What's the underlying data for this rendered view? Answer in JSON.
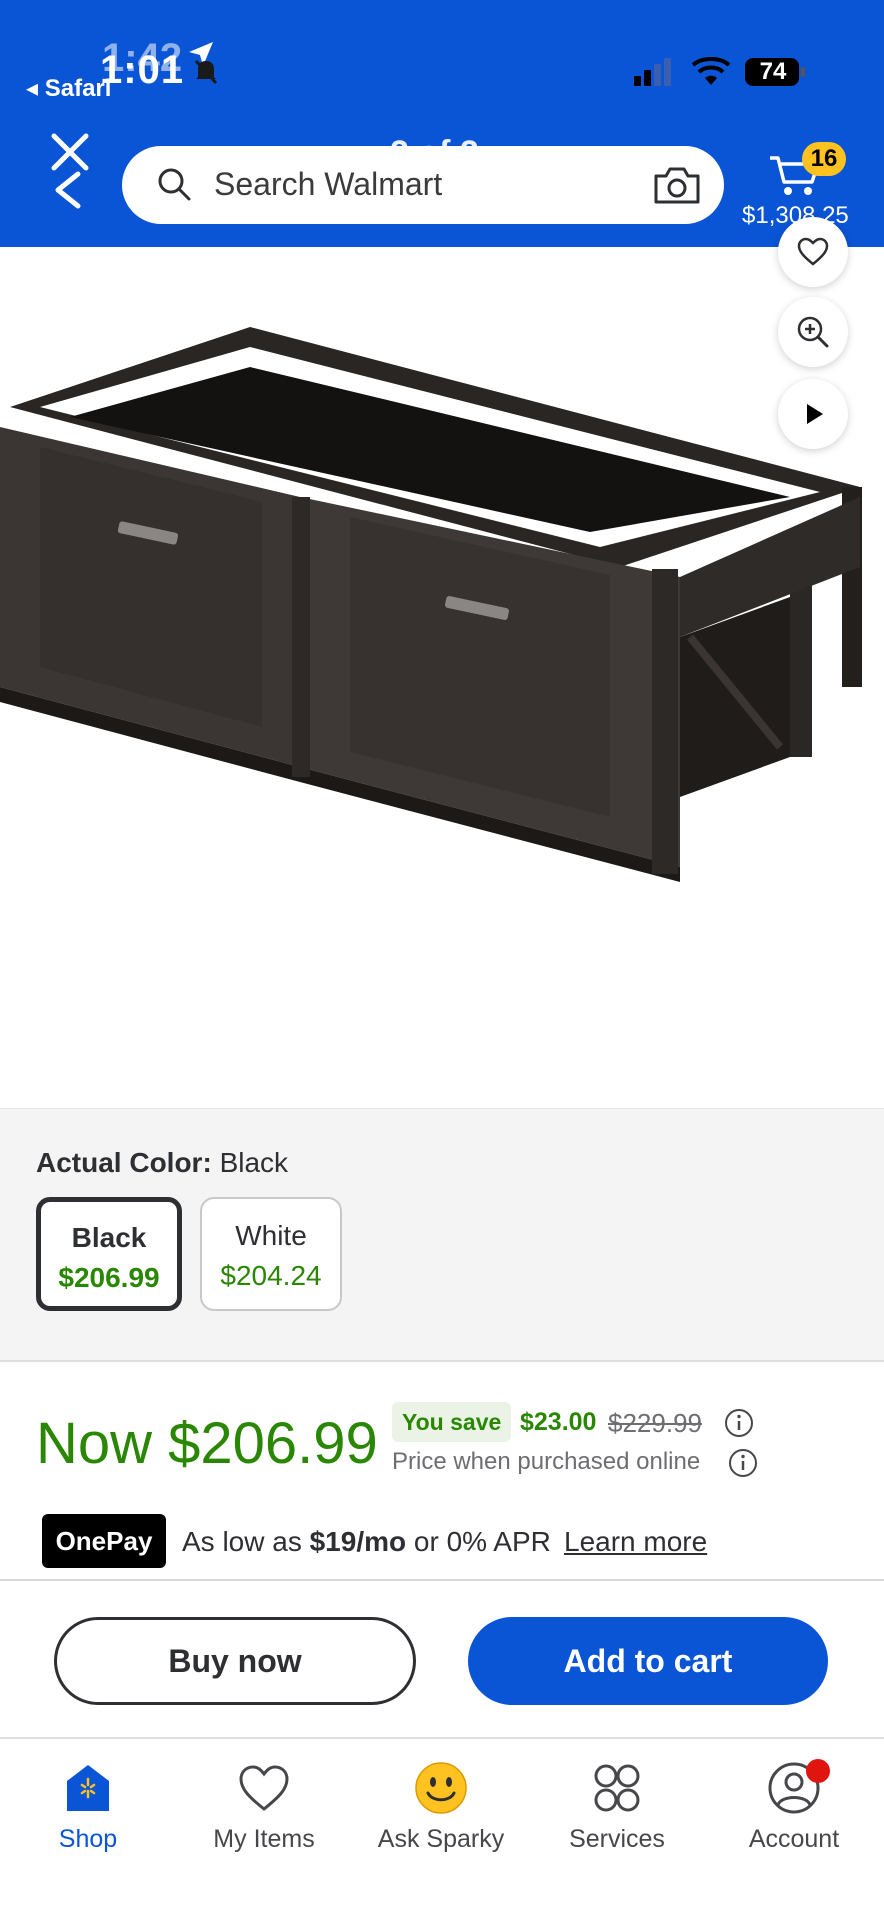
{
  "status_bar": {
    "time": "1:01",
    "time_ghost": "1:42",
    "back_app": "◂ Safari",
    "battery": "74"
  },
  "header": {
    "search_placeholder": "Search Walmart",
    "page_counter": "2 of 2",
    "cart_count": "16",
    "cart_total": "$1,308.25",
    "brand_color": "#0a54d6"
  },
  "gallery": {
    "image_count": 9,
    "active_index": 0
  },
  "color_selector": {
    "label": "Actual Color:",
    "value": "Black",
    "options": [
      {
        "name": "Black",
        "price": "$206.99",
        "selected": true
      },
      {
        "name": "White",
        "price": "$204.24",
        "selected": false
      }
    ]
  },
  "price": {
    "now": "Now $206.99",
    "you_save_label": "You save",
    "save_amount": "$23.00",
    "was": "$229.99",
    "online_note": "Price when purchased online",
    "onepay_logo": "OnePay",
    "onepay_prefix": "As low as ",
    "onepay_amount": "$19/mo",
    "onepay_suffix": " or 0% APR",
    "learn_more": "Learn more"
  },
  "actions": {
    "buy_now": "Buy now",
    "add_to_cart": "Add to cart"
  },
  "bottom_nav": [
    {
      "label": "Shop",
      "icon": "shop-icon"
    },
    {
      "label": "My Items",
      "icon": "heart-icon"
    },
    {
      "label": "Ask Sparky",
      "icon": "sparky-smiley-icon"
    },
    {
      "label": "Services",
      "icon": "services-grid-icon"
    },
    {
      "label": "Account",
      "icon": "account-icon"
    }
  ]
}
